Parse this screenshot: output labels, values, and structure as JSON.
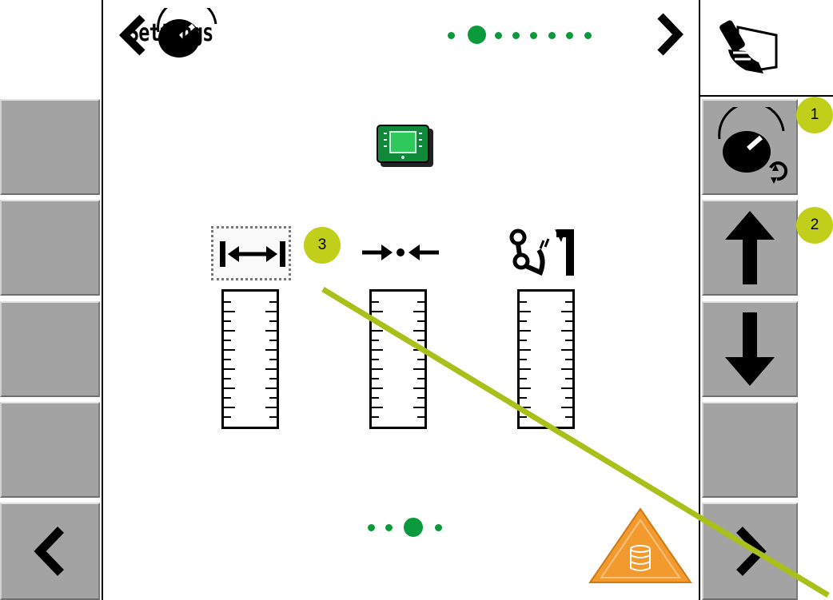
{
  "header": {
    "title": "Settings",
    "back_icon": "chevron-left-icon",
    "gauge_icon": "dial-gauge-icon",
    "forward_icon": "chevron-right-icon",
    "page_indicator": {
      "total": 8,
      "active": 2
    }
  },
  "right_softkeys": [
    {
      "icon": "manual-control-icon"
    },
    {
      "icon": "gauge-cycle-icon"
    },
    {
      "icon": "arrow-up-icon"
    },
    {
      "icon": "arrow-down-icon"
    },
    {
      "icon": ""
    },
    {
      "icon": "chevron-right-icon"
    }
  ],
  "left_softkeys": [
    {
      "icon": ""
    },
    {
      "icon": ""
    },
    {
      "icon": ""
    },
    {
      "icon": ""
    },
    {
      "icon": "chevron-left-icon"
    }
  ],
  "main": {
    "module_icon": "terminal-module-icon",
    "parameters": [
      {
        "icon": "width-icon",
        "selected": true
      },
      {
        "icon": "narrow-center-icon",
        "selected": false
      },
      {
        "icon": "hitch-arm-icon",
        "selected": false
      }
    ],
    "sub_page_indicator": {
      "total": 4,
      "active": 3
    },
    "warning_icon": "storage-warning-icon"
  },
  "markers": [
    "1",
    "2",
    "3"
  ],
  "colors": {
    "softkey": "#a3a3a3",
    "indicator": "#0a9a3c",
    "marker": "#c1cf1a",
    "warning": "#f39a2e"
  }
}
